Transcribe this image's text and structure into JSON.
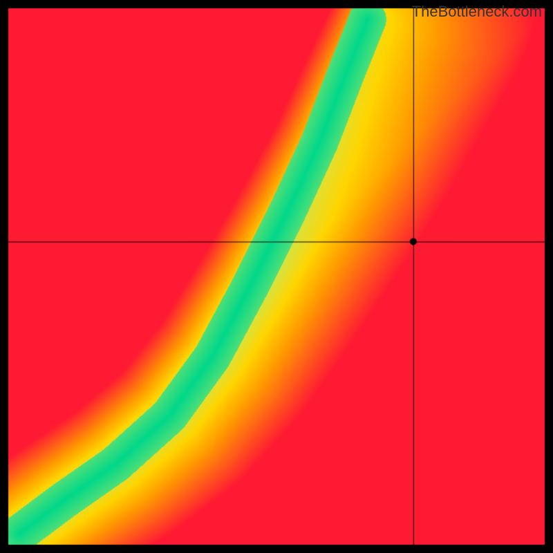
{
  "watermark": "TheBottleneck.com",
  "chart_data": {
    "type": "heatmap",
    "title": "",
    "xlabel": "",
    "ylabel": "",
    "xlim": [
      0,
      1
    ],
    "ylim": [
      0,
      1
    ],
    "grid": false,
    "legend": false,
    "canvas_size": 800,
    "border_width": 12,
    "border_color": "#000000",
    "ridge": {
      "comment": "Green optimal ridge path from bottom-left to top, normalized coords (origin bottom-left). Heatmap value falls off with distance from this curve.",
      "points": [
        {
          "x": 0.02,
          "y": 0.02
        },
        {
          "x": 0.1,
          "y": 0.08
        },
        {
          "x": 0.2,
          "y": 0.15
        },
        {
          "x": 0.3,
          "y": 0.24
        },
        {
          "x": 0.38,
          "y": 0.35
        },
        {
          "x": 0.45,
          "y": 0.48
        },
        {
          "x": 0.52,
          "y": 0.62
        },
        {
          "x": 0.58,
          "y": 0.75
        },
        {
          "x": 0.63,
          "y": 0.88
        },
        {
          "x": 0.67,
          "y": 0.98
        }
      ],
      "half_width_green": 0.035,
      "half_width_yellow": 0.12
    },
    "corner_bias": {
      "comment": "Additional warm gradient: lower-right and upper-left go toward red, near-ridge is green, mid distances yellow/orange.",
      "lower_right_color": "#ff2a2a",
      "upper_left_color": "#ff2a2a",
      "mid_color": "#ffcc00",
      "ridge_color": "#00d88a"
    },
    "crosshair": {
      "x": 0.755,
      "y": 0.565,
      "marker_radius_px": 5,
      "line_color": "#000000",
      "line_width": 1,
      "marker_color": "#000000"
    },
    "color_stops": [
      {
        "t": 0.0,
        "color": "#00d88a"
      },
      {
        "t": 0.2,
        "color": "#c8e85a"
      },
      {
        "t": 0.4,
        "color": "#ffd500"
      },
      {
        "t": 0.6,
        "color": "#ff9a00"
      },
      {
        "t": 0.8,
        "color": "#ff5a1a"
      },
      {
        "t": 1.0,
        "color": "#ff1a33"
      }
    ]
  }
}
